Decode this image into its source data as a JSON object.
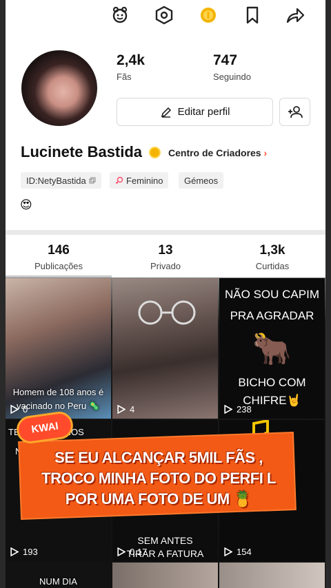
{
  "header": {
    "icons": [
      "mascot-icon",
      "hexagon-settings-icon",
      "coin-icon",
      "bookmark-icon",
      "share-icon"
    ],
    "accent": "#ff4d2d",
    "coin_color": "#f4b400"
  },
  "profile": {
    "stats": [
      {
        "value": "2,4k",
        "label": "Fãs"
      },
      {
        "value": "747",
        "label": "Seguindo"
      }
    ],
    "edit_label": "Editar perfil",
    "name": "Lucinete Bastida",
    "creator_center": "Centro de Criadores",
    "creator_chevron": "›",
    "chips": {
      "id": "ID:NetyBastida",
      "gender": "Feminino",
      "sign": "Gémeos"
    },
    "bio_emoji": "😍"
  },
  "tabs": [
    {
      "value": "146",
      "label": "Publicações"
    },
    {
      "value": "13",
      "label": "Privado"
    },
    {
      "value": "1,3k",
      "label": "Curtidas"
    }
  ],
  "grid": {
    "row1": [
      {
        "plays": "0",
        "caption": "Homem de 108 anos é vacinado no Peru 🦠"
      },
      {
        "plays": "4"
      },
      {
        "plays": "238",
        "lines": [
          "NÃO SOU CAPIM",
          "PRA AGRADAR",
          "🐂",
          "BICHO COM",
          "CHIFRE🤘"
        ]
      }
    ],
    "row2": [
      {
        "plays": "193",
        "top_text": "TE ACONSELHOS",
        "sub_text": "N"
      },
      {
        "plays": "0.17",
        "bottom_text": "SEM ANTES",
        "bottom_text2": "TIRAR A FATURA"
      },
      {
        "plays": "154"
      }
    ],
    "row3": [
      {
        "top_text": "NUM DIA"
      }
    ]
  },
  "overlay": {
    "logo": "KWAI",
    "message": "SE EU ALCANÇAR 5MIL FÃS , TROCO MINHA FOTO DO PERFI L POR UMA FOTO DE UM 🍍"
  }
}
